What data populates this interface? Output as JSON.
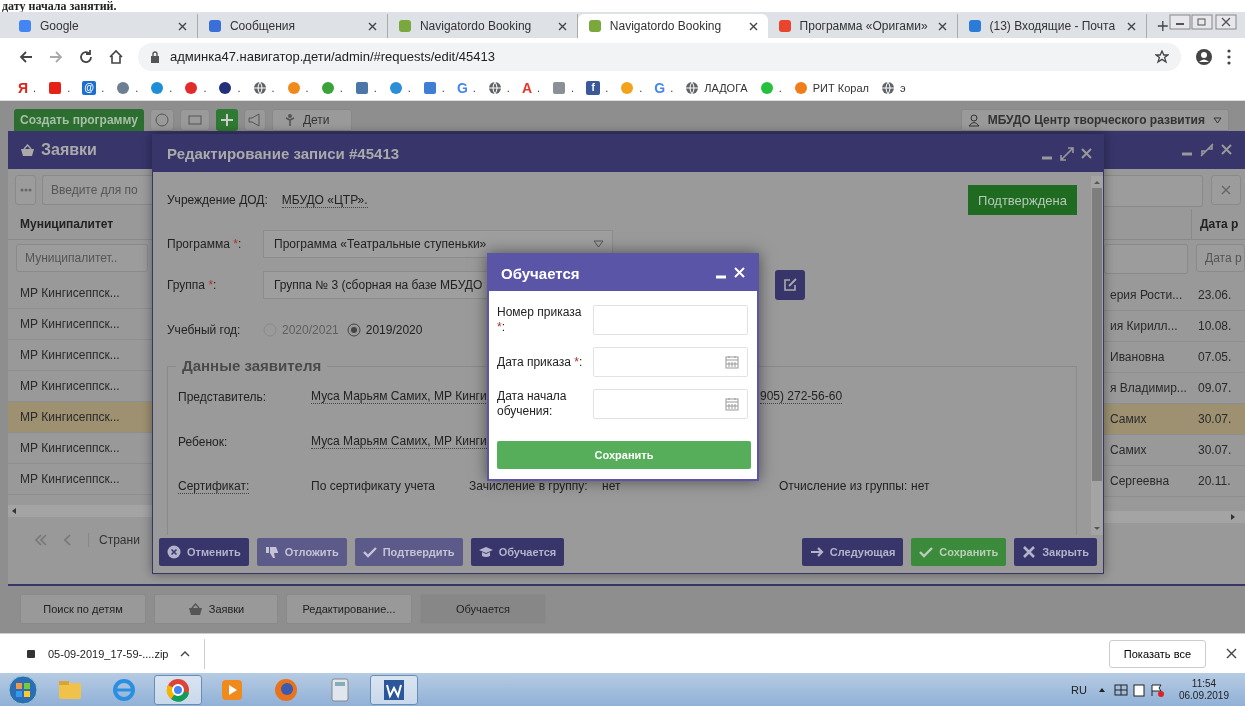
{
  "doc_text": "дату начала занятий.",
  "browser": {
    "tabs": [
      {
        "title": "Google",
        "color": "#4285f4",
        "selected": false
      },
      {
        "title": "Сообщения",
        "color": "#3b6fd8",
        "selected": false
      },
      {
        "title": "Navigatordo Booking",
        "color": "#7aa83c",
        "selected": false
      },
      {
        "title": "Navigatordo Booking",
        "color": "#7aa83c",
        "selected": true
      },
      {
        "title": "Программа «Оригами»",
        "color": "#e8452c",
        "selected": false
      },
      {
        "title": "(13) Входящие - Почта",
        "color": "#2b7bd9",
        "selected": false
      }
    ],
    "address": "админка47.навигатор.дети/admin/#requests/edit/45413",
    "bookmarks": [
      {
        "kind": "letter",
        "glyph": "Я",
        "color": "#e0241b",
        "label": "."
      },
      {
        "kind": "tile",
        "color": "#e62117",
        "label": "."
      },
      {
        "kind": "tile",
        "color": "#1b6fd1",
        "glyph": "@",
        "label": "."
      },
      {
        "kind": "dot",
        "color": "#6a7f92",
        "label": "."
      },
      {
        "kind": "dot",
        "color": "#1e8fd6",
        "label": "."
      },
      {
        "kind": "dot",
        "color": "#e22b2b",
        "label": "."
      },
      {
        "kind": "dot",
        "color": "#23307a",
        "label": "."
      },
      {
        "kind": "globe",
        "color": "#5f6368",
        "label": "."
      },
      {
        "kind": "dot",
        "color": "#f08a1c",
        "label": "."
      },
      {
        "kind": "dot",
        "color": "#3aa33a",
        "label": "."
      },
      {
        "kind": "tile",
        "color": "#4a76a8",
        "label": "."
      },
      {
        "kind": "dot",
        "color": "#2c8ed8",
        "label": "."
      },
      {
        "kind": "tile",
        "color": "#3f7fd3",
        "label": "."
      },
      {
        "kind": "letter",
        "glyph": "G",
        "color": "#4285f4",
        "label": "."
      },
      {
        "kind": "globe",
        "color": "#5f6368",
        "label": "."
      },
      {
        "kind": "letter",
        "glyph": "А",
        "color": "#e8332b",
        "label": "."
      },
      {
        "kind": "tile",
        "color": "#8a9096",
        "label": "."
      },
      {
        "kind": "tile",
        "color": "#3b5998",
        "glyph": "f",
        "label": "."
      },
      {
        "kind": "dot",
        "color": "#f2a31b",
        "label": "."
      },
      {
        "kind": "letter",
        "glyph": "G",
        "color": "#4285f4",
        "label": "."
      },
      {
        "kind": "globe",
        "color": "#5f6368",
        "label": "ЛАДОГА"
      },
      {
        "kind": "dot",
        "color": "#25c03e",
        "label": "."
      },
      {
        "kind": "dot",
        "color": "#f07d1a",
        "label": "РИТ Корал"
      },
      {
        "kind": "globe",
        "color": "#5f6368",
        "label": "э"
      }
    ]
  },
  "app_toolbar": {
    "create_button": "Создать программу",
    "children_button": "Дети",
    "user": "МБУДО Центр творческого развития"
  },
  "requests_window": {
    "title": "Заявки",
    "search_placeholder": "Введите для по",
    "columns": [
      "Муниципалитет",
      "Дата р"
    ],
    "filter_placeholders": [
      "Муниципалитет..",
      "Дата р"
    ],
    "rows": [
      {
        "municipality": "МР Кингисеппск...",
        "column_2": "ерия Рости...",
        "date": "23.06.",
        "selected": false
      },
      {
        "municipality": "МР Кингисеппск...",
        "column_2": "ия Кирилл...",
        "date": "10.08.",
        "selected": false
      },
      {
        "municipality": "МР Кингисеппск...",
        "column_2": "Ивановна",
        "date": "07.05.",
        "selected": false
      },
      {
        "municipality": "МР Кингисеппск...",
        "column_2": "я Владимир...",
        "date": "09.07.",
        "selected": false
      },
      {
        "municipality": "МР Кингисеппск...",
        "column_2": "Самих",
        "date": "30.07.",
        "selected": true
      },
      {
        "municipality": "МР Кингисеппск...",
        "column_2": "Самих",
        "date": "30.07.",
        "selected": false
      },
      {
        "municipality": "МР Кингисеппск...",
        "column_2": "Сергеевна",
        "date": "20.11.",
        "selected": false
      }
    ],
    "pager": "Страни"
  },
  "edit_dialog": {
    "title": "Редактирование записи #45413",
    "status_button": "Подтверждена",
    "institution_label": "Учреждение ДОД:",
    "institution": "МБУДО «ЦТР».",
    "program_label": "Программа",
    "program_required": "*",
    "program_colon": ":",
    "program": "Программа «Театральные ступеньки»",
    "group_label": "Группа",
    "group_required": "*",
    "group_colon": ":",
    "group": "Группа № 3 (сборная на базе МБУДО",
    "year_label": "Учебный год:",
    "years": [
      {
        "label": "2020/2021",
        "selected": false,
        "disabled": true
      },
      {
        "label": "2019/2020",
        "selected": true,
        "disabled": false
      }
    ],
    "fieldset_title": "Данные заявителя",
    "representative_label": "Представитель:",
    "representative": "Муса Марьям Самих, МР Кинги",
    "representative_phone": "905) 272-56-60",
    "child_label": "Ребенок:",
    "child": "Муса Марьям Самих, МР Кинги",
    "certificate_label": "Сертификат:",
    "certificate": "По сертификату учета",
    "enrollment_label": "Зачисление в группу:",
    "enrollment": "нет",
    "expulsion_label": "Отчисление из группы:",
    "expulsion": "нет",
    "buttons": [
      {
        "kind": "cancel",
        "label": "Отменить",
        "disabled": false
      },
      {
        "kind": "postpone",
        "label": "Отложить",
        "disabled": true
      },
      {
        "kind": "confirm",
        "label": "Подтвердить",
        "disabled": true
      },
      {
        "kind": "learning",
        "label": "Обучается",
        "disabled": false
      }
    ],
    "right_buttons": [
      {
        "kind": "next",
        "label": "Следующая",
        "disabled": false
      },
      {
        "kind": "save",
        "label": "Сохранить",
        "disabled": false
      },
      {
        "kind": "close",
        "label": "Закрыть",
        "disabled": false
      }
    ]
  },
  "modal": {
    "title": "Обучается",
    "fields": [
      {
        "label": "Номер приказа",
        "required_mark": "*",
        "colon": ":",
        "kind": "text"
      },
      {
        "label": "Дата приказа",
        "required_mark": "*",
        "colon": ":",
        "kind": "date"
      },
      {
        "label": "Дата начала обучения:",
        "kind": "date"
      }
    ],
    "save_button": "Сохранить"
  },
  "task_buttons": [
    {
      "label": "Поиск по детям",
      "icon": false,
      "selected": false
    },
    {
      "label": "Заявки",
      "icon": true,
      "selected": false
    },
    {
      "label": "Редактирование...",
      "icon": false,
      "selected": false
    },
    {
      "label": "Обучается",
      "icon": false,
      "selected": true
    }
  ],
  "downloads": {
    "file": "05-09-2019_17-59-....zip",
    "show_all": "Показать все"
  },
  "taskbar": {
    "apps": [
      {
        "kind": "explorer",
        "selected": false
      },
      {
        "kind": "ie",
        "selected": false
      },
      {
        "kind": "chrome",
        "selected": true
      },
      {
        "kind": "player",
        "selected": false
      },
      {
        "kind": "firefox",
        "selected": false
      },
      {
        "kind": "calculator",
        "selected": false
      },
      {
        "kind": "word",
        "selected": true
      }
    ],
    "lang": "RU",
    "time": "11:54",
    "date": "06.09.2019"
  }
}
